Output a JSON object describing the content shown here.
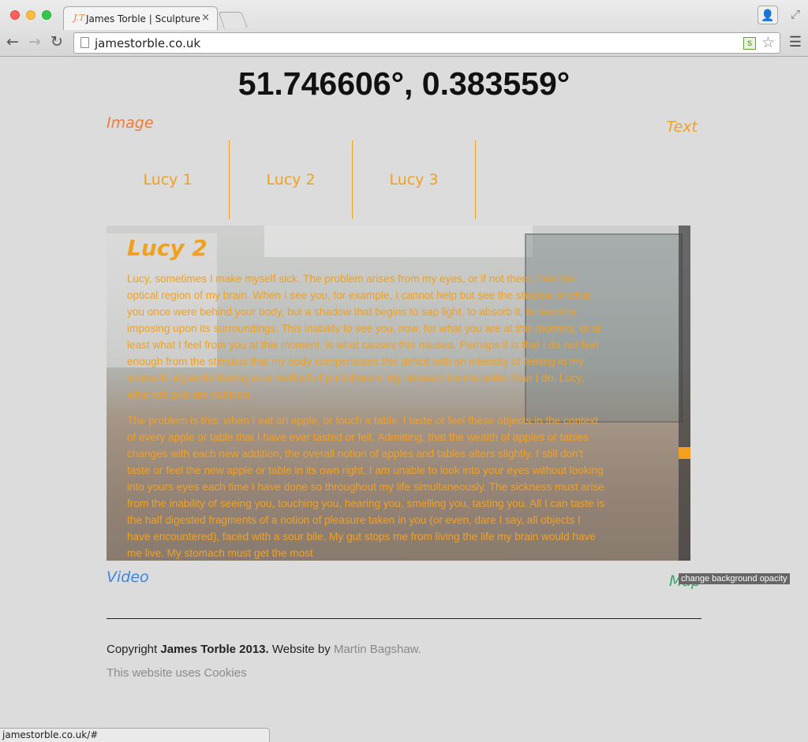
{
  "browser": {
    "tab_favicon": "J.T",
    "tab_title": "James Torble | Sculpture",
    "tab_close": "×",
    "url": "jamestorble.co.uk",
    "status_url": "jamestorble.co.uk/#",
    "icons": {
      "back": "back-arrow-icon",
      "forward": "forward-arrow-icon",
      "reload": "reload-icon",
      "star": "star-icon",
      "menu": "menu-icon"
    }
  },
  "page": {
    "coordinates": "51.746606°, 0.383559°",
    "links": {
      "image": "Image",
      "text": "Text",
      "video": "Video",
      "map": "Map"
    },
    "lucy_nav": [
      "Lucy 1",
      "Lucy 2",
      "Lucy 3"
    ],
    "panel": {
      "title": "Lucy 2",
      "paragraphs": [
        " Lucy, sometimes I make myself sick. The problem arises from my eyes, or if not them, then the optical region of my brain. When I see you, for example, I cannot help but see the shadow of what you once were behind your body, but a shadow that begins to sap light, to absorb it, to become imposing upon its surroundings. This inability to see you, now, for what you are at this moment, or at least what I feel from you at this moment, is what causes this nausea. Perhaps it is that I do not feel enough from the stimulus that my body compensates this deficit with an intensity of feeling in my stomach. A painful feeling as a method of punishment. My stomach knows better than I do, Lucy, what will give me nutrition.",
        " The problem is this: when I eat an apple, or touch a table, I taste or feel these objects in the context of every apple or table that I have ever tasted or felt. Admitting, that the wealth of apples or tables changes with each new addition, the overall notion of apples and tables alters slightly. I still don't taste or feel the new apple or table in its own right. I am unable to look into your eyes without looking into yours eyes each time I have done so throughout my life simultaneously. The sickness must arise from the inability of seeing you, touching you, hearing you, smelling you, tasting you. All I can taste is the half digested fragments of a notion of pleasure taken in you (or even, dare I say, all objects I have encountered), faced with a sour bile. My gut stops me from living the life my brain would have me live. My stomach must get the most"
      ]
    },
    "opacity_button": "change background opacity",
    "footer": {
      "copyright_prefix": "Copyright ",
      "copyright_owner": "James Torble 2013.",
      "website_by": " Website by ",
      "author": "Martin Bagshaw.",
      "cookies": "This website uses Cookies"
    },
    "colors": {
      "orange": "#f2a020",
      "image_link": "#f07a3a",
      "video_link": "#3a86e0",
      "map_link": "#3aa86a",
      "background": "#dcdcdc"
    }
  }
}
